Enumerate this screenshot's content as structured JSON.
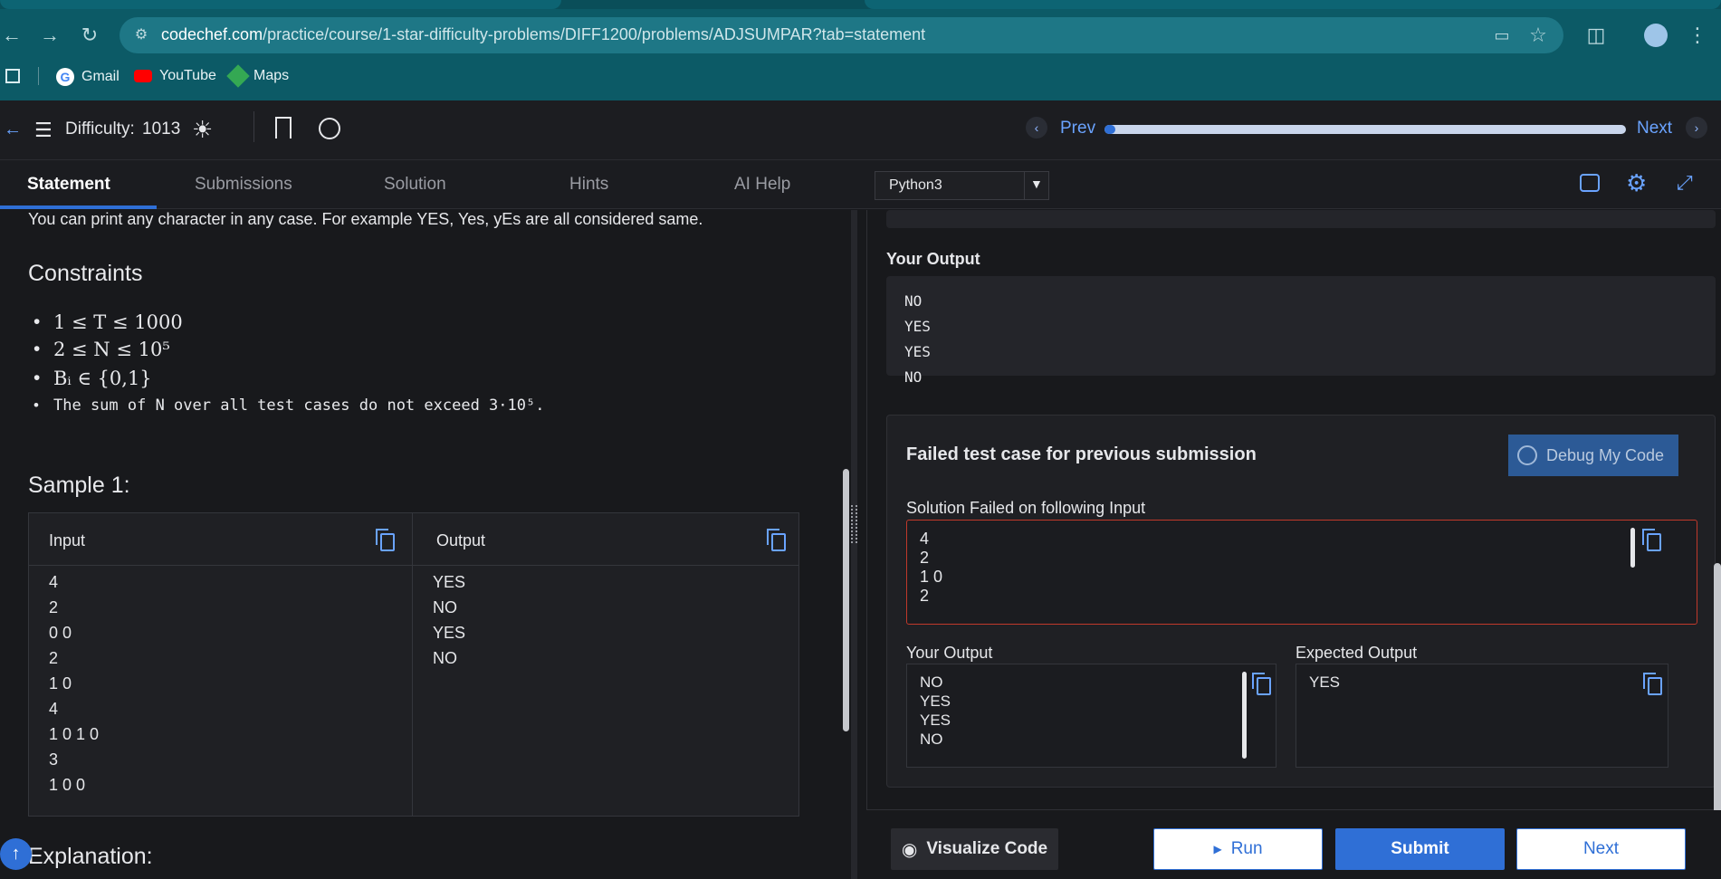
{
  "browser": {
    "url_domain": "codechef.com",
    "url_path": "/practice/course/1-star-difficulty-problems/DIFF1200/problems/ADJSUMPAR?tab=statement",
    "bookmarks": [
      "Gmail",
      "YouTube",
      "Maps"
    ]
  },
  "appbar": {
    "difficulty_label": "Difficulty:",
    "difficulty_value": "1013",
    "prev_label": "Prev",
    "next_label": "Next",
    "progress": 0.02
  },
  "tabs": [
    "Statement",
    "Submissions",
    "Solution",
    "Hints",
    "AI Help"
  ],
  "language": "Python3",
  "statement": {
    "case_note": "You can print any character in any case. For example YES, Yes, yEs are all considered same.",
    "constraints_title": "Constraints",
    "constraints": [
      "1 ≤ T ≤ 1000",
      "2 ≤ N ≤ 10⁵",
      "Bᵢ ∈ {0,1}",
      "The sum of N over all test cases do not exceed 3·10⁵."
    ],
    "sample_title": "Sample 1:",
    "input_label": "Input",
    "output_label": "Output",
    "input_lines": [
      "4",
      "2",
      "0 0",
      "2",
      "1 0",
      "4",
      "1 0 1 0",
      "3",
      "1 0 0"
    ],
    "output_lines": [
      "YES",
      "NO",
      "YES",
      "NO"
    ],
    "explanation_title": "Explanation:"
  },
  "right": {
    "your_output_label": "Your Output",
    "your_output_lines": [
      "NO",
      "YES",
      "YES",
      "NO"
    ],
    "failed_title": "Failed test case for previous submission",
    "debug_label": "Debug My Code",
    "failed_input_label": "Solution Failed on following Input",
    "failed_input_lines": [
      "4",
      "2",
      "1 0",
      "2"
    ],
    "your_output2_label": "Your Output",
    "your_output2_lines": [
      "NO",
      "YES",
      "YES",
      "NO"
    ],
    "expected_label": "Expected Output",
    "expected_lines": [
      "YES"
    ]
  },
  "footer": {
    "visualize_label": "Visualize Code",
    "run_label": "Run",
    "submit_label": "Submit",
    "next_label": "Next"
  },
  "colors": {
    "accent": "#2f6fd6",
    "chrome": "#0c5a66",
    "error": "#c0392b"
  }
}
